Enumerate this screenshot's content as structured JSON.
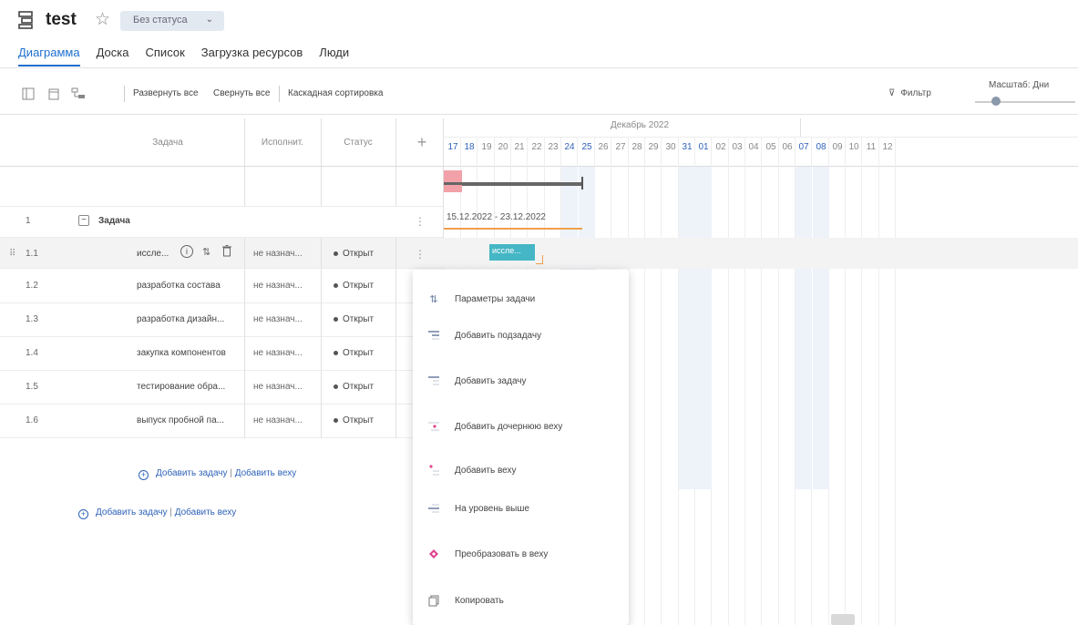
{
  "header": {
    "project_title": "test",
    "status_select": "Без статуса"
  },
  "tabs": [
    {
      "label": "Диаграмма",
      "active": true
    },
    {
      "label": "Доска"
    },
    {
      "label": "Список"
    },
    {
      "label": "Загрузка ресурсов"
    },
    {
      "label": "Люди"
    }
  ],
  "toolbar": {
    "expand_all": "Развернуть все",
    "collapse_all": "Свернуть все",
    "cascade_sort": "Каскадная сортировка",
    "filter": "Фильтр",
    "scale": "Масштаб: Дни"
  },
  "grid": {
    "columns": [
      "Задача",
      "Исполнит.",
      "Статус"
    ],
    "add_column": "+"
  },
  "timeline": {
    "month": "Декабрь 2022",
    "days": [
      "17",
      "18",
      "19",
      "20",
      "21",
      "22",
      "23",
      "24",
      "25",
      "26",
      "27",
      "28",
      "29",
      "30",
      "31",
      "01",
      "02",
      "03",
      "04",
      "05",
      "06",
      "07",
      "08",
      "09",
      "10",
      "11",
      "12"
    ],
    "weekend_days": [
      "17",
      "18",
      "24",
      "25",
      "31",
      "01",
      "07",
      "08"
    ],
    "date_range_label": "15.12.2022 - 23.12.2022",
    "bar_label": "иссле..."
  },
  "rows": [
    {
      "num": "1",
      "name": "Задача",
      "assignee": "",
      "status": "",
      "parent": true
    },
    {
      "num": "1.1",
      "name": "иссле...",
      "assignee": "не назнач...",
      "status": "Открыт",
      "hover": true
    },
    {
      "num": "1.2",
      "name": "разработка состава",
      "assignee": "не назнач...",
      "status": "Открыт"
    },
    {
      "num": "1.3",
      "name": "разработка дизайн...",
      "assignee": "не назнач...",
      "status": "Открыт"
    },
    {
      "num": "1.4",
      "name": "закупка компонентов",
      "assignee": "не назнач...",
      "status": "Открыт"
    },
    {
      "num": "1.5",
      "name": "тестирование обра...",
      "assignee": "не назнач...",
      "status": "Открыт"
    },
    {
      "num": "1.6",
      "name": "выпуск пробной па...",
      "assignee": "не назнач...",
      "status": "Открыт"
    }
  ],
  "add_links": {
    "add_task": "Добавить задачу",
    "separator": "|",
    "add_milestone": "Добавить веху"
  },
  "context_menu": [
    {
      "label": "Параметры задачи",
      "icon": "sliders-icon"
    },
    {
      "label": "Добавить подзадачу",
      "icon": "add-subtask-icon"
    },
    {
      "label": "Добавить задачу",
      "icon": "add-task-icon"
    },
    {
      "label": "Добавить дочернюю веху",
      "icon": "add-child-milestone-icon"
    },
    {
      "label": "Добавить веху",
      "icon": "add-milestone-icon"
    },
    {
      "label": "На уровень выше",
      "icon": "outdent-icon"
    },
    {
      "label": "Преобразовать в веху",
      "icon": "diamond-icon"
    },
    {
      "label": "Копировать",
      "icon": "copy-icon"
    }
  ],
  "colors": {
    "accent": "#1e6fd0",
    "teal_bar": "#45b6c5",
    "milestone": "#e0438f",
    "weekend": "#eef3fa"
  }
}
